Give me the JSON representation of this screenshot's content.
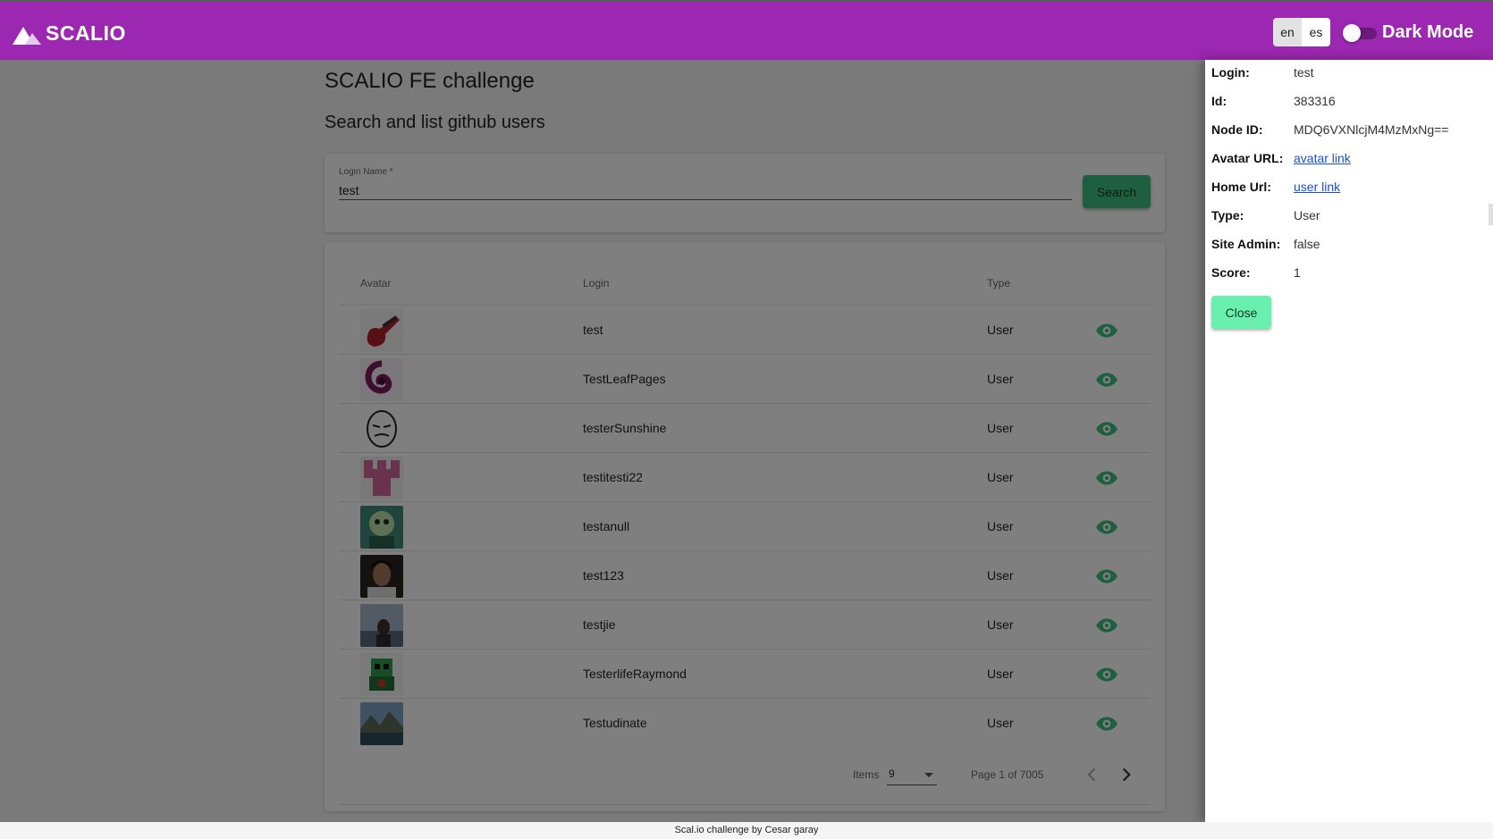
{
  "header": {
    "logo_text": "SCALIO",
    "languages": [
      "en",
      "es"
    ],
    "active_language": "en",
    "dark_mode_label": "Dark Mode",
    "dark_mode_on": false,
    "colors": {
      "bar": "#9c27b0",
      "accent_green": "#3cbd83"
    }
  },
  "page": {
    "title": "SCALIO FE challenge",
    "subtitle": "Search and list github users"
  },
  "search": {
    "label": "Login Name *",
    "value": "test",
    "button": "Search"
  },
  "table": {
    "columns": [
      "Avatar",
      "Login",
      "Type"
    ],
    "rows": [
      {
        "login": "test",
        "type": "User",
        "avatar": "guitar-avatar"
      },
      {
        "login": "TestLeafPages",
        "type": "User",
        "avatar": "swirl-avatar"
      },
      {
        "login": "testerSunshine",
        "type": "User",
        "avatar": "meme-face-avatar"
      },
      {
        "login": "testitesti22",
        "type": "User",
        "avatar": "pink-identicon-avatar"
      },
      {
        "login": "testanull",
        "type": "User",
        "avatar": "cartoon-avatar"
      },
      {
        "login": "test123",
        "type": "User",
        "avatar": "photo-avatar"
      },
      {
        "login": "testjie",
        "type": "User",
        "avatar": "photo-avatar"
      },
      {
        "login": "TesterlifeRaymond",
        "type": "User",
        "avatar": "green-character-avatar"
      },
      {
        "login": "Testudinate",
        "type": "User",
        "avatar": "landscape-avatar"
      }
    ],
    "action_icon": "eye-icon"
  },
  "pagination": {
    "items_label": "Items",
    "items_value": "9",
    "page_info": "Page 1 of 7005"
  },
  "drawer": {
    "fields": [
      {
        "label": "Login:",
        "value": "test"
      },
      {
        "label": "Id:",
        "value": "383316"
      },
      {
        "label": "Node ID:",
        "value": "MDQ6VXNlcjM4MzMxNg=="
      },
      {
        "label": "Avatar URL:",
        "value": "avatar link",
        "link": true
      },
      {
        "label": "Home Url:",
        "value": "user link",
        "link": true
      },
      {
        "label": "Type:",
        "value": "User"
      },
      {
        "label": "Site Admin:",
        "value": "false"
      },
      {
        "label": "Score:",
        "value": "1"
      }
    ],
    "close_label": "Close"
  },
  "footer": {
    "text": "Scal.io challenge by Cesar garay"
  }
}
